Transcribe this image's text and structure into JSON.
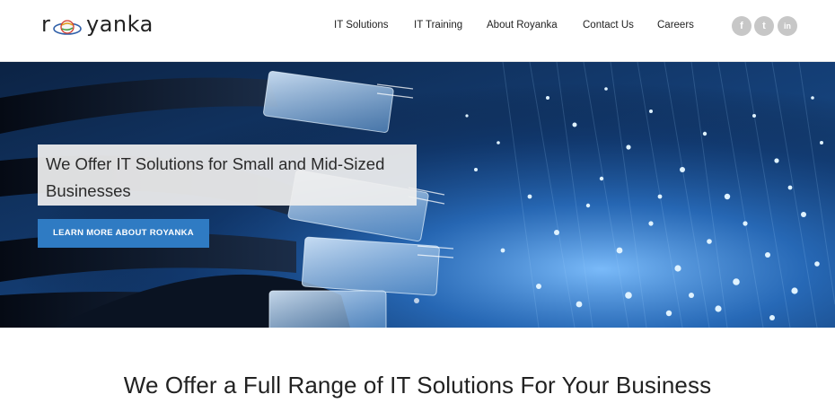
{
  "brand": {
    "logo_prefix": "r",
    "logo_suffix": "yanka"
  },
  "nav": {
    "items": [
      {
        "label": "IT Solutions"
      },
      {
        "label": "IT Training"
      },
      {
        "label": "About Royanka"
      },
      {
        "label": "Contact Us"
      },
      {
        "label": "Careers"
      }
    ]
  },
  "social": {
    "items": [
      {
        "icon": "facebook-icon",
        "glyph": "f"
      },
      {
        "icon": "twitter-icon",
        "glyph": "t"
      },
      {
        "icon": "linkedin-icon",
        "glyph": "in"
      }
    ]
  },
  "hero": {
    "title": "We Offer IT Solutions for Small and Mid-Sized Businesses",
    "button_label": "LEARN MORE ABOUT ROYANKA"
  },
  "section": {
    "title": "We Offer a Full Range of IT Solutions For Your Business"
  },
  "colors": {
    "accent": "#2f7bc3",
    "social_icon_bg": "#c7c7c7"
  }
}
